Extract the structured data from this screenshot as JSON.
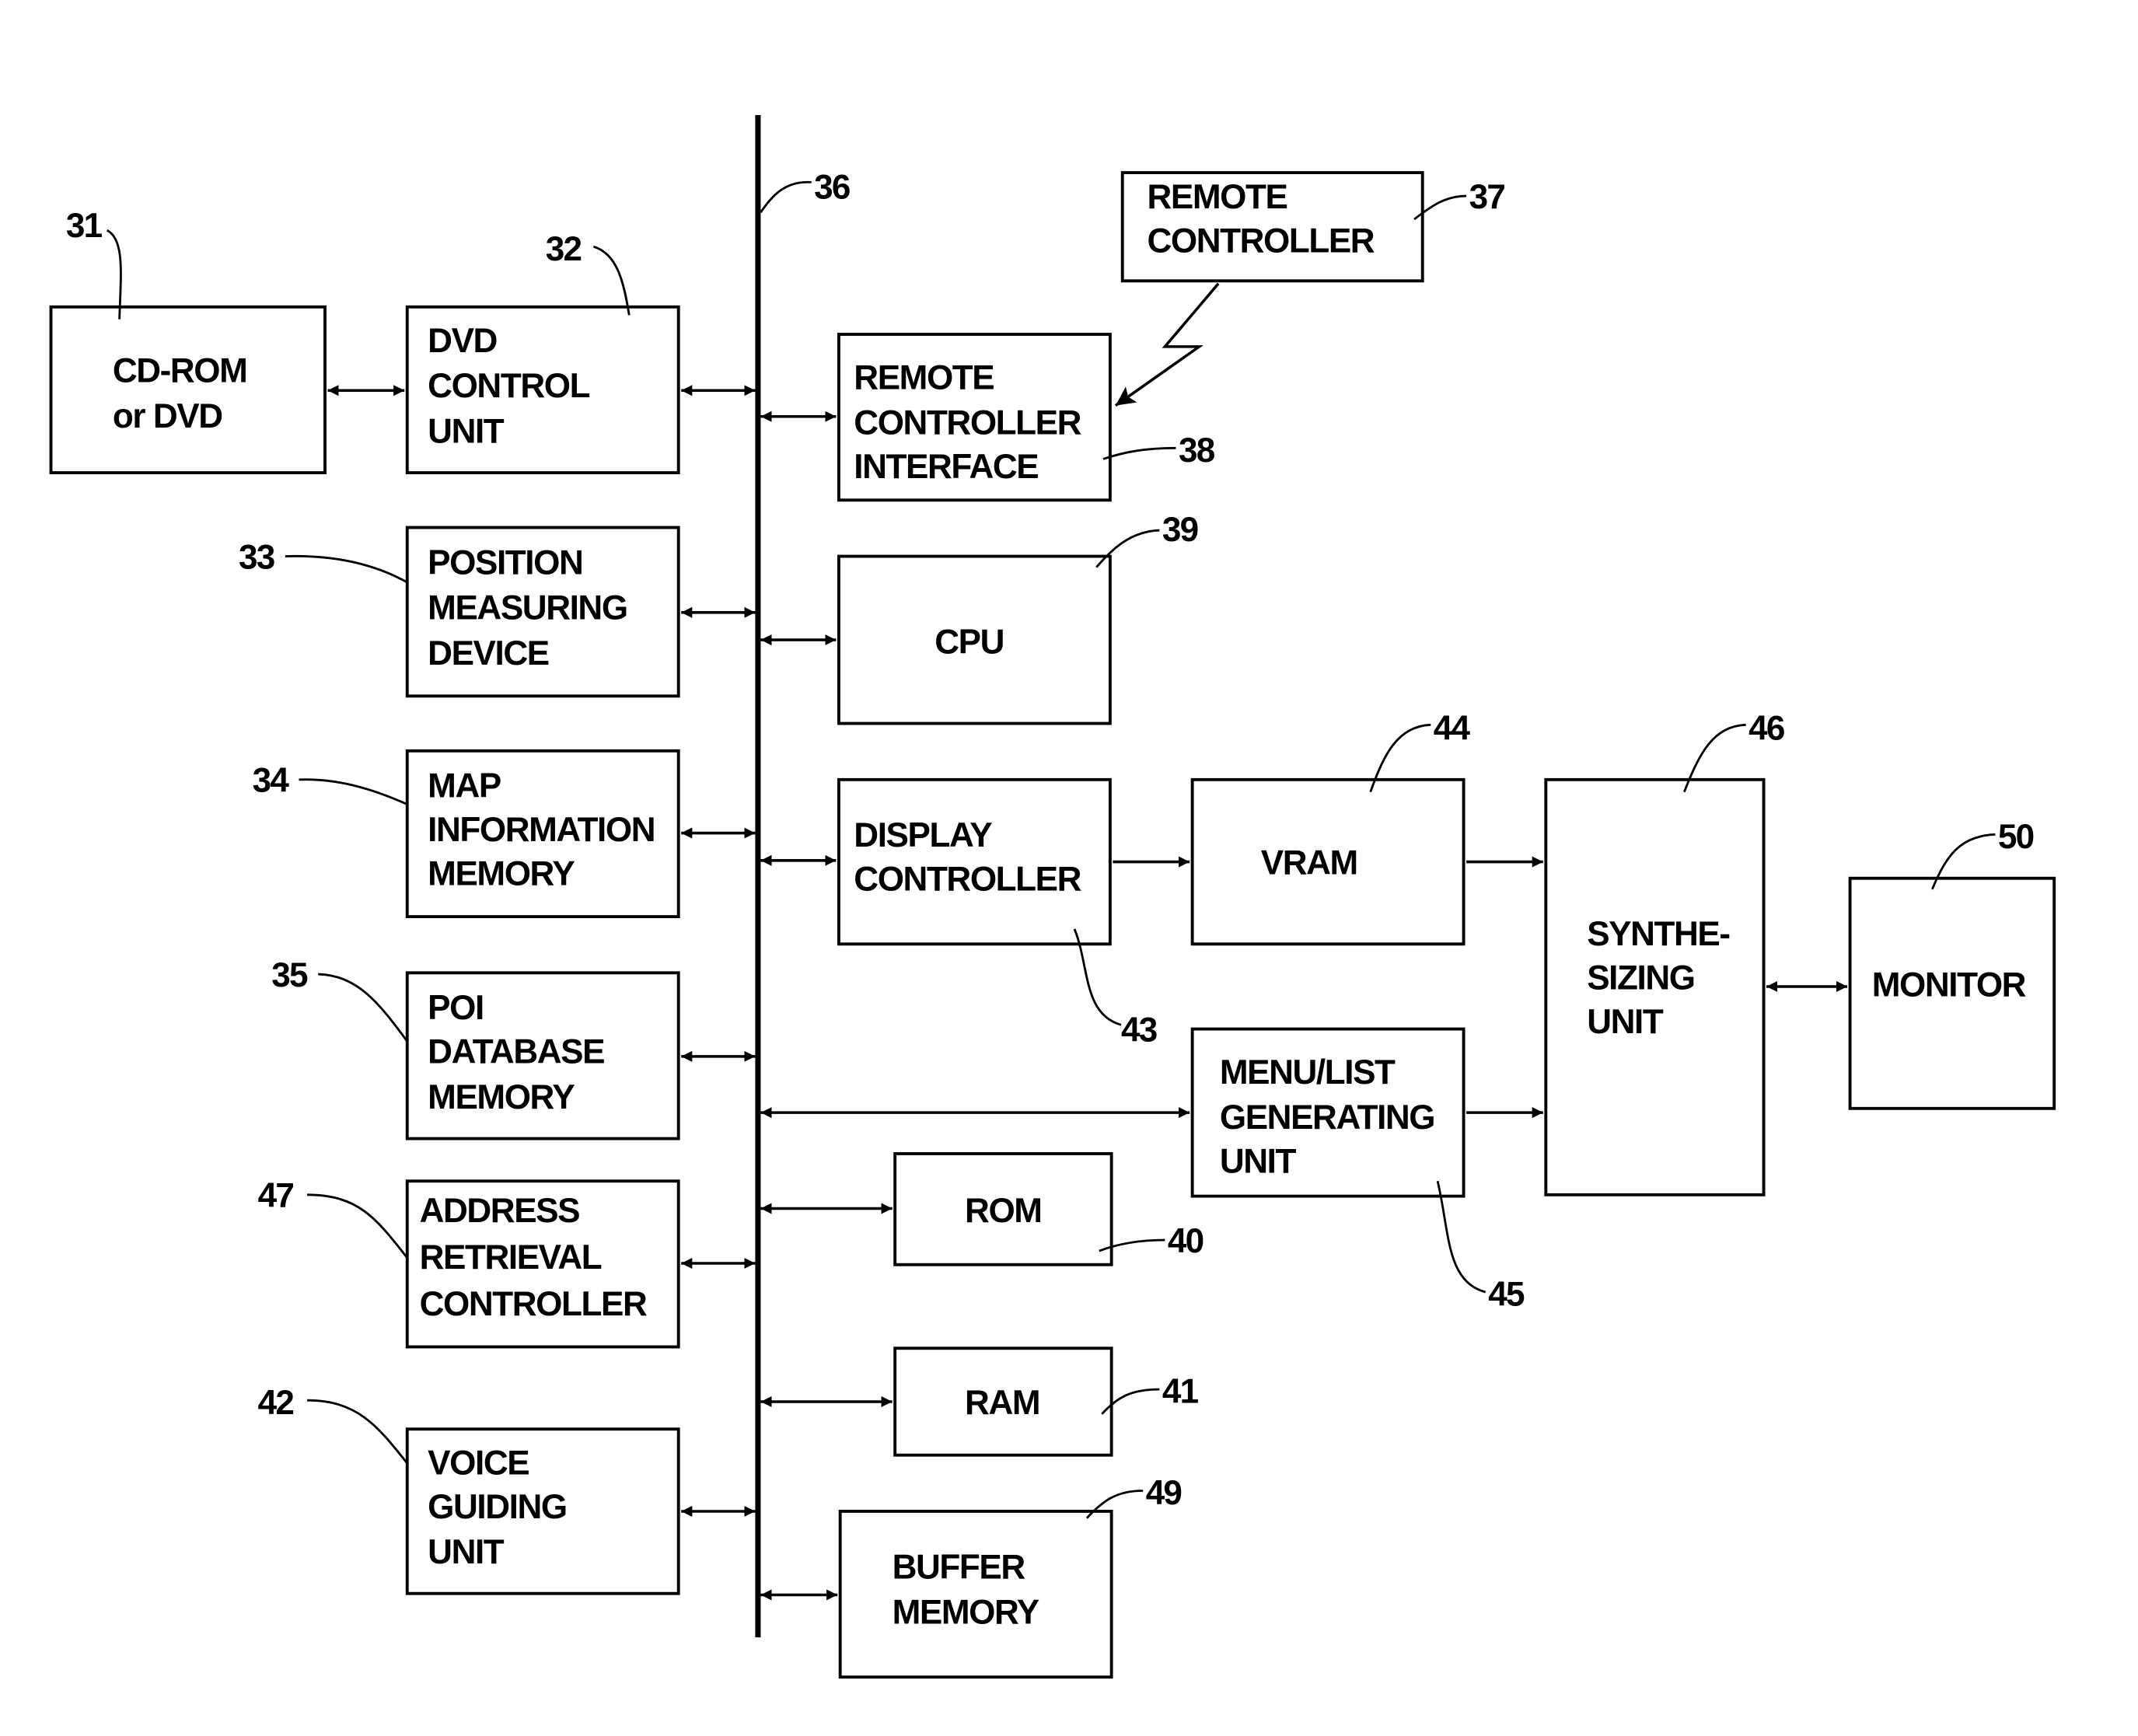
{
  "diagram": {
    "bus_ref": "36",
    "blocks": [
      {
        "id": "cdrom",
        "ref": "31",
        "lines": [
          "CD-ROM",
          "or DVD"
        ]
      },
      {
        "id": "dvd-control",
        "ref": "32",
        "lines": [
          "DVD",
          "CONTROL",
          "UNIT"
        ]
      },
      {
        "id": "position",
        "ref": "33",
        "lines": [
          "POSITION",
          "MEASURING",
          "DEVICE"
        ]
      },
      {
        "id": "map-memory",
        "ref": "34",
        "lines": [
          "MAP",
          "INFORMATION",
          "MEMORY"
        ]
      },
      {
        "id": "poi-memory",
        "ref": "35",
        "lines": [
          "POI",
          "DATABASE",
          "MEMORY"
        ]
      },
      {
        "id": "address-retrieval",
        "ref": "47",
        "lines": [
          "ADDRESS",
          "RETRIEVAL",
          "CONTROLLER"
        ]
      },
      {
        "id": "voice-guiding",
        "ref": "42",
        "lines": [
          "VOICE",
          "GUIDING",
          "UNIT"
        ]
      },
      {
        "id": "remote-controller",
        "ref": "37",
        "lines": [
          "REMOTE",
          "CONTROLLER"
        ]
      },
      {
        "id": "remote-interface",
        "ref": "38",
        "lines": [
          "REMOTE",
          "CONTROLLER",
          "INTERFACE"
        ]
      },
      {
        "id": "cpu",
        "ref": "39",
        "lines": [
          "CPU"
        ]
      },
      {
        "id": "display-controller",
        "ref": "43",
        "lines": [
          "DISPLAY",
          "CONTROLLER"
        ]
      },
      {
        "id": "vram",
        "ref": "44",
        "lines": [
          "VRAM"
        ]
      },
      {
        "id": "synthesizing",
        "ref": "46",
        "lines": [
          "SYNTHE-",
          "SIZING",
          "UNIT"
        ]
      },
      {
        "id": "monitor",
        "ref": "50",
        "lines": [
          "MONITOR"
        ]
      },
      {
        "id": "menu-list",
        "ref": "45",
        "lines": [
          "MENU/LIST",
          "GENERATING",
          "UNIT"
        ]
      },
      {
        "id": "rom",
        "ref": "40",
        "lines": [
          "ROM"
        ]
      },
      {
        "id": "ram",
        "ref": "41",
        "lines": [
          "RAM"
        ]
      },
      {
        "id": "buffer",
        "ref": "49",
        "lines": [
          "BUFFER",
          "MEMORY"
        ]
      }
    ]
  }
}
